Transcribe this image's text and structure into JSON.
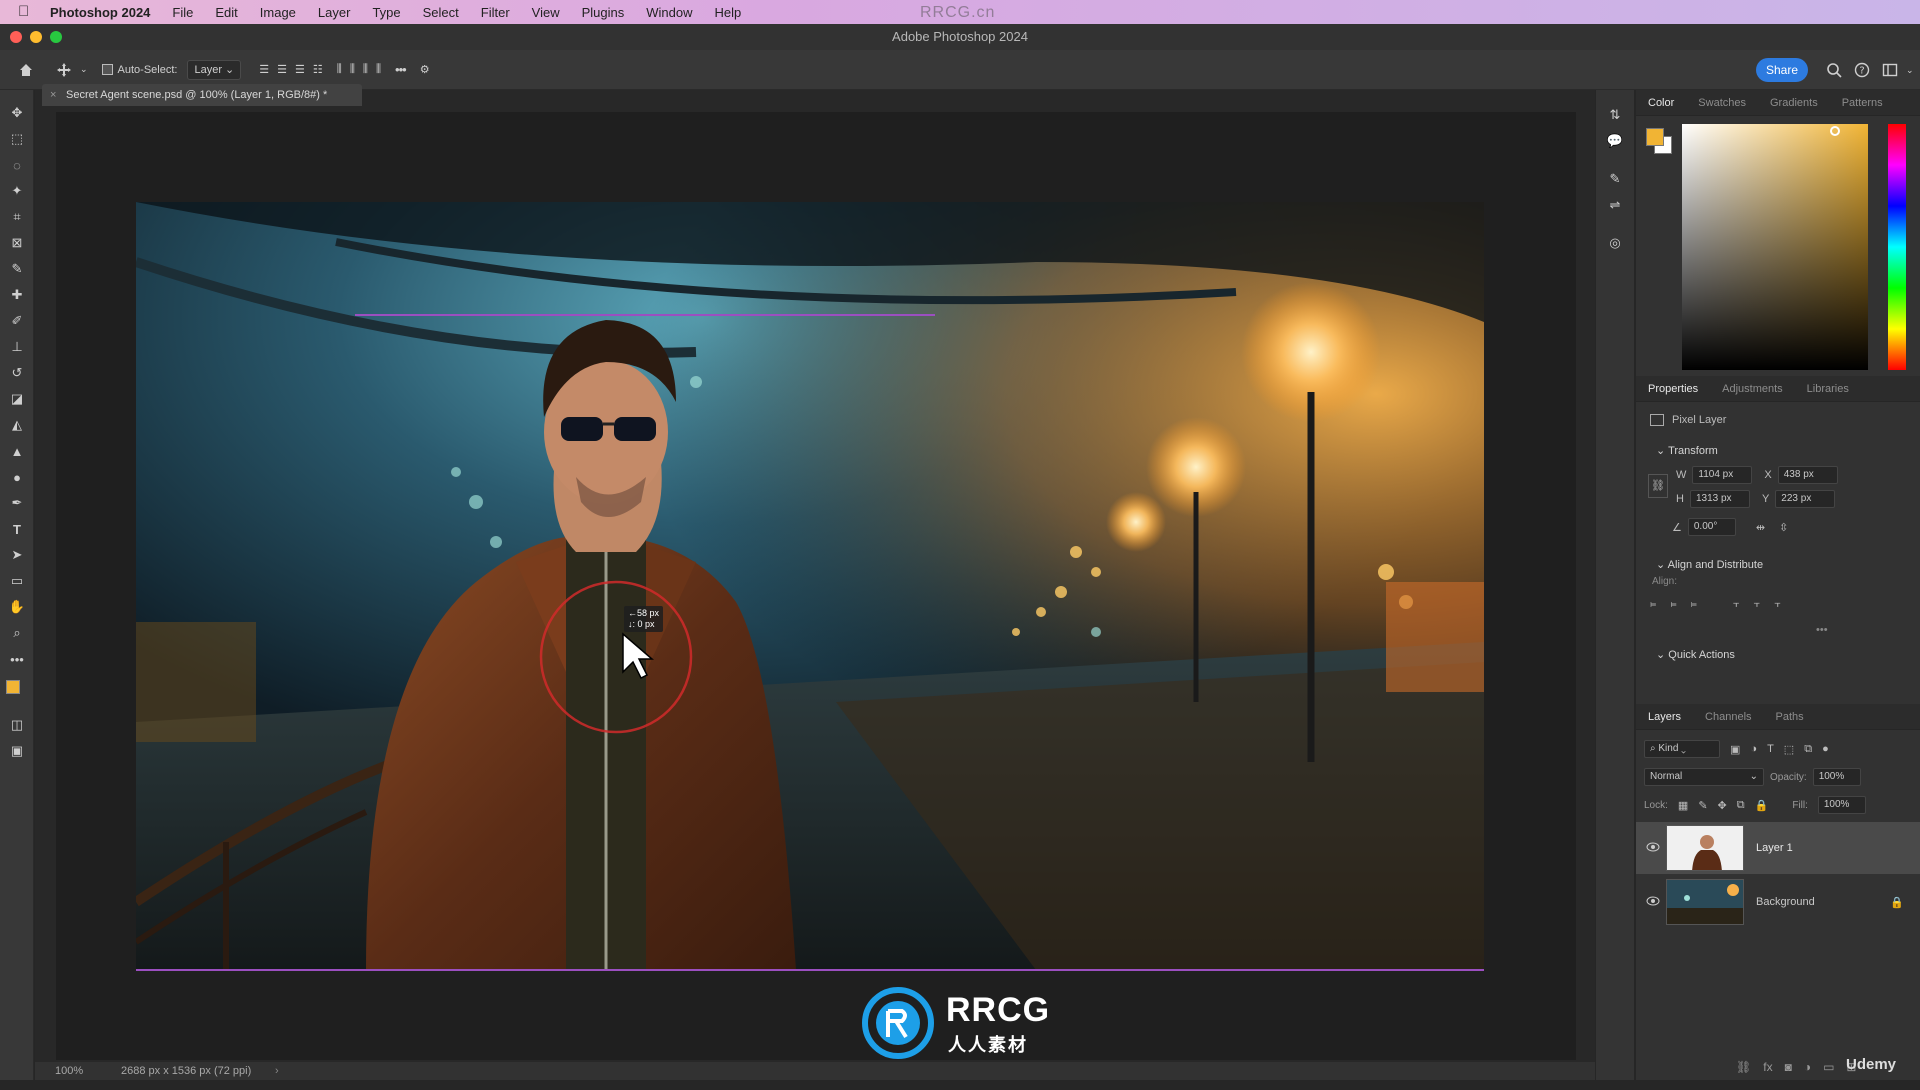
{
  "menubar": {
    "app_name": "Photoshop 2024",
    "items": [
      "File",
      "Edit",
      "Image",
      "Layer",
      "Type",
      "Select",
      "Filter",
      "View",
      "Plugins",
      "Window",
      "Help"
    ],
    "watermark": "RRCG.cn"
  },
  "window": {
    "title": "Adobe Photoshop 2024"
  },
  "options": {
    "auto_select_label": "Auto-Select:",
    "auto_select_value": "Layer",
    "more_label": "•••",
    "share_label": "Share"
  },
  "document": {
    "tab_label": "Secret Agent scene.psd @ 100% (Layer 1, RGB/8#) *",
    "zoom": "100%",
    "dims": "2688 px x 1536 px (72 ppi)",
    "move_readout_x": "←58 px",
    "move_readout_y": "↓: 0 px"
  },
  "color_panel": {
    "tabs": [
      "Color",
      "Swatches",
      "Gradients",
      "Patterns"
    ],
    "foreground": "#f1b434",
    "background": "#ffffff"
  },
  "properties_panel": {
    "tabs": [
      "Properties",
      "Adjustments",
      "Libraries"
    ],
    "kind": "Pixel Layer",
    "transform_title": "Transform",
    "w_label": "W",
    "w_value": "1104 px",
    "x_label": "X",
    "x_value": "438 px",
    "h_label": "H",
    "h_value": "1313 px",
    "y_label": "Y",
    "y_value": "223 px",
    "angle_value": "0.00°",
    "align_title": "Align and Distribute",
    "align_label": "Align:",
    "quick_actions_title": "Quick Actions"
  },
  "layers_panel": {
    "tabs": [
      "Layers",
      "Channels",
      "Paths"
    ],
    "kind_label": "Kind",
    "blend_mode": "Normal",
    "opacity_label": "Opacity:",
    "opacity_value": "100%",
    "lock_label": "Lock:",
    "fill_label": "Fill:",
    "fill_value": "100%",
    "layers": [
      {
        "name": "Layer 1"
      },
      {
        "name": "Background"
      }
    ]
  },
  "branding": {
    "logo_text": "RRCG",
    "logo_sub": "人人素材",
    "udemy": "Udemy"
  }
}
